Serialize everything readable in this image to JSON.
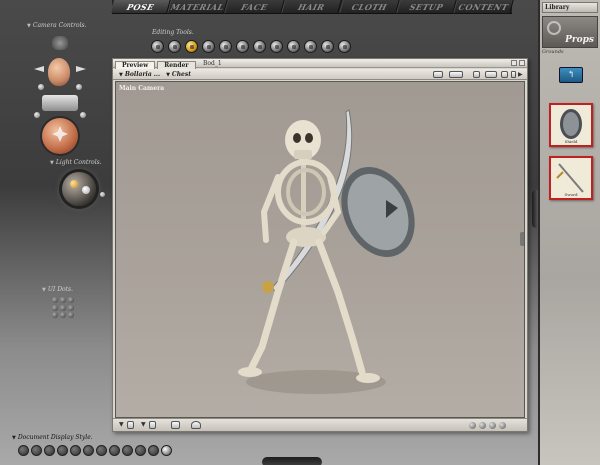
{
  "top_tabs": [
    {
      "label": "POSE",
      "active": true
    },
    {
      "label": "MATERIAL",
      "active": false
    },
    {
      "label": "FACE",
      "active": false
    },
    {
      "label": "HAIR",
      "active": false
    },
    {
      "label": "CLOTH",
      "active": false
    },
    {
      "label": "SETUP",
      "active": false
    },
    {
      "label": "CONTENT",
      "active": false
    }
  ],
  "left_panel": {
    "camera_controls_label": "Camera Controls.",
    "light_controls_label": "Light Controls.",
    "ui_dots_label": "UI Dots.",
    "document_display_style_label": "Document Display Style."
  },
  "editing_tools": {
    "label": "Editing Tools.",
    "tools": [
      "rotate-icon",
      "twist-icon",
      "translate-icon",
      "translate-in-out-icon",
      "scale-icon",
      "taper-icon",
      "chain-break-icon",
      "color-icon",
      "grouping-icon",
      "view-magnifier-icon",
      "morphing-tool-icon",
      "direct-manipulation-icon"
    ],
    "active_index": 2
  },
  "document": {
    "title": "Bod_1",
    "tabs": [
      {
        "label": "Preview",
        "active": true
      },
      {
        "label": "Render",
        "active": false
      }
    ],
    "figure_select": "Bollaria ...",
    "part_select": "Chest",
    "camera_label": "Main Camera"
  },
  "library": {
    "title": "Library",
    "category": "Props",
    "subcategory": "Grounds",
    "items": [
      {
        "label": "Shield",
        "icon": "shield-thumbnail"
      },
      {
        "label": "Sword",
        "icon": "sword-thumbnail"
      }
    ]
  },
  "colors": {
    "accent": "#d29a15",
    "viewport_bg": "#aaa39b",
    "thumb_border": "#c02020"
  }
}
